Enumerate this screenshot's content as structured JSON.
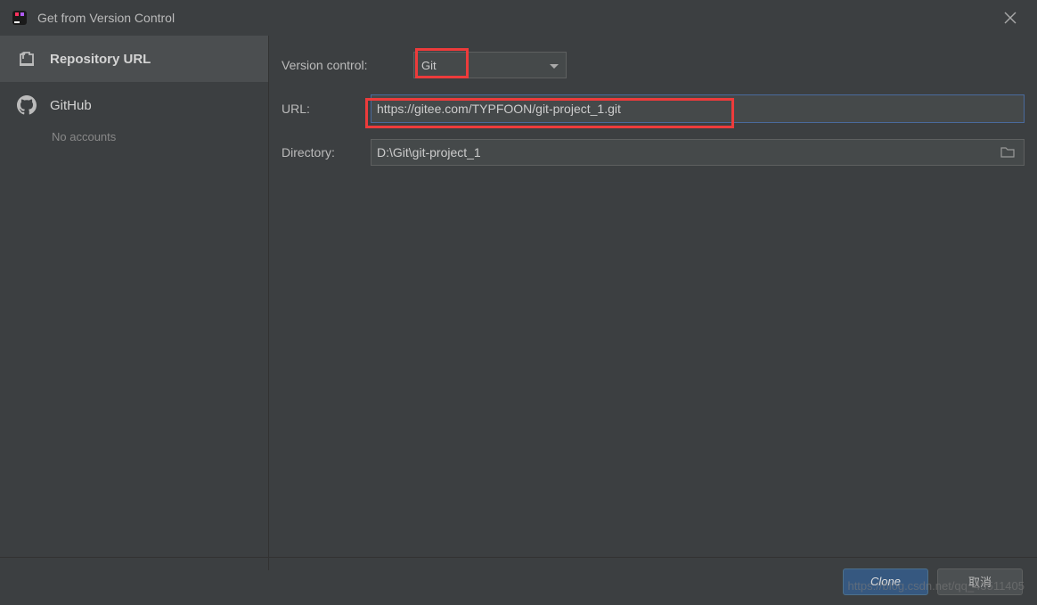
{
  "titlebar": {
    "title": "Get from Version Control"
  },
  "sidebar": {
    "items": [
      {
        "label": "Repository URL"
      },
      {
        "label": "GitHub",
        "sub": "No accounts"
      }
    ]
  },
  "form": {
    "vc_label": "Version control:",
    "vc_value": "Git",
    "url_label": "URL:",
    "url_value": "https://gitee.com/TYPFOON/git-project_1.git",
    "dir_label": "Directory:",
    "dir_value": "D:\\Git\\git-project_1"
  },
  "footer": {
    "clone": "Clone",
    "cancel": "取消"
  },
  "watermark": "https://blog.csdn.net/qq_43511405"
}
